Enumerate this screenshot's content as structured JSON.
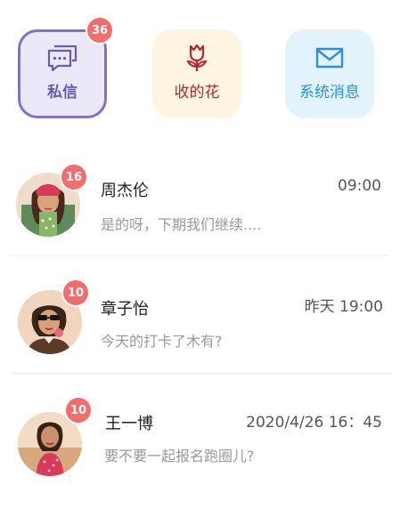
{
  "tiles": {
    "private": {
      "label": "私信",
      "badge": "36",
      "icon": "chat-bubbles-icon",
      "color": "#8371c4"
    },
    "flowers": {
      "label": "收的花",
      "icon": "flower-icon",
      "color": "#b4262a"
    },
    "system": {
      "label": "系统消息",
      "icon": "envelope-icon",
      "color": "#2d8fd6"
    }
  },
  "messages": [
    {
      "name": "周杰伦",
      "time": "09:00",
      "preview": "是的呀，下期我们继续....",
      "badge": "16"
    },
    {
      "name": "章子怡",
      "time": "昨天  19:00",
      "preview": "今天的打卡了木有?",
      "badge": "10"
    },
    {
      "name": "王一博",
      "time": "2020/4/26 16：45",
      "preview": "要不要一起报名跑圈儿?",
      "badge": "10"
    }
  ],
  "colors": {
    "badge": "#f26d6d",
    "divider": "#ececec"
  }
}
